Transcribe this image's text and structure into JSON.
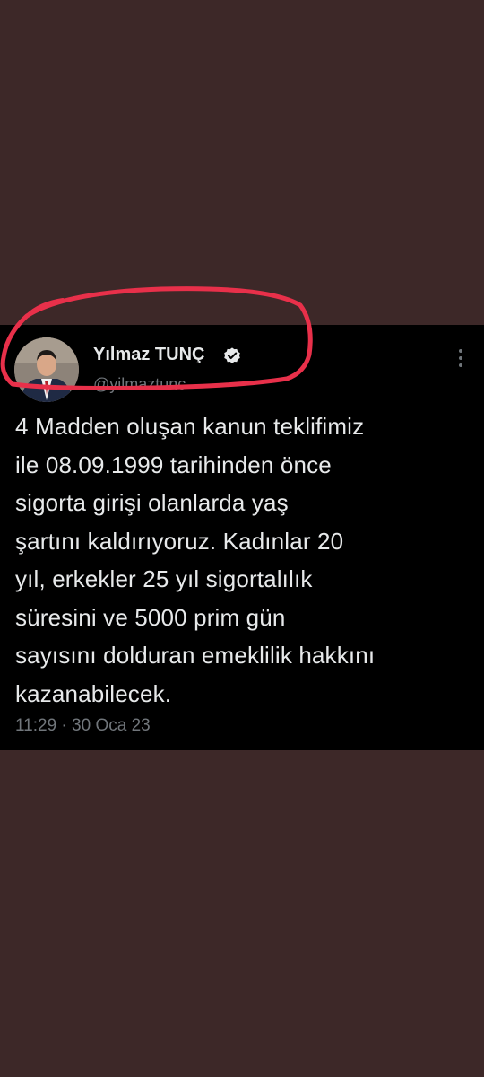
{
  "tweet": {
    "author_name": "Yılmaz TUNÇ",
    "author_handle": "@yilmaztunc",
    "text_lines": [
      "4 Madden oluşan kanun teklifimiz",
      "ile 08.09.1999 tarihinden önce",
      "sigorta girişi olanlarda yaş",
      "şartını kaldırıyoruz. Kadınlar 20",
      "yıl, erkekler 25 yıl sigortalılık",
      "süresini ve 5000 prim gün",
      "sayısını dolduran emeklilik hakkını",
      "kazanabilecek."
    ],
    "time": "11:29",
    "separator": "·",
    "date": "30 Oca 23"
  },
  "icons": {
    "verified": "verified-badge-icon",
    "more": "more-options-icon"
  },
  "colors": {
    "page_background": "#3d2828",
    "card_background": "#000000",
    "primary_text": "#e7e9ea",
    "secondary_text": "#71767b",
    "annotation": "#e8304a"
  }
}
